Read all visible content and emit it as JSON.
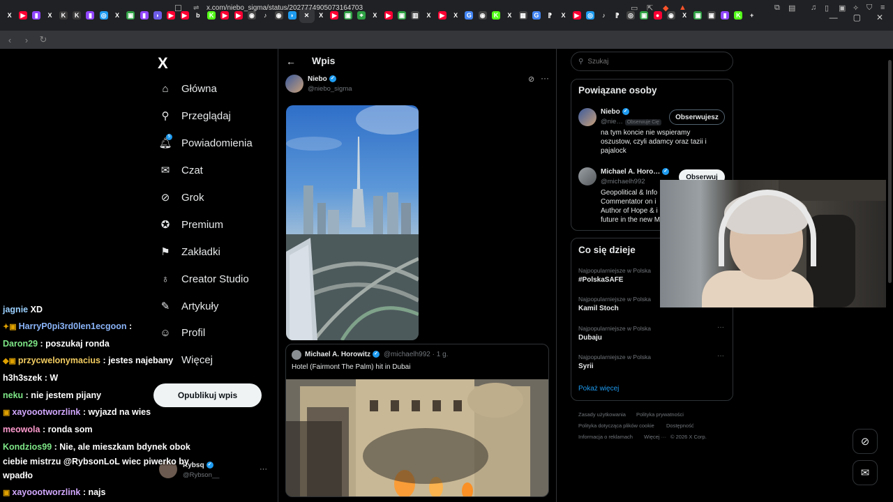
{
  "browser": {
    "tabs": [
      {
        "glyph": "X",
        "color": "#202124"
      },
      {
        "glyph": "▶",
        "color": "#ff0033"
      },
      {
        "glyph": "▮",
        "color": "#9146ff"
      },
      {
        "glyph": "X",
        "color": "#202124"
      },
      {
        "glyph": "K",
        "color": "#3a3a3a"
      },
      {
        "glyph": "K",
        "color": "#3a3a3a"
      },
      {
        "glyph": "▮",
        "color": "#9146ff"
      },
      {
        "glyph": "◎",
        "color": "#1d9bf0"
      },
      {
        "glyph": "X",
        "color": "#202124"
      },
      {
        "glyph": "▣",
        "color": "#2ea043"
      },
      {
        "glyph": "▮",
        "color": "#9146ff"
      },
      {
        "glyph": "◗",
        "color": "#6c5ce7"
      },
      {
        "glyph": "▶",
        "color": "#ff0033"
      },
      {
        "glyph": "▶",
        "color": "#ff0033"
      },
      {
        "glyph": "b",
        "color": "#202124"
      },
      {
        "glyph": "K",
        "color": "#53fc18"
      },
      {
        "glyph": "▶",
        "color": "#ff0033"
      },
      {
        "glyph": "▶",
        "color": "#ff0033"
      },
      {
        "glyph": "◉",
        "color": "#444"
      },
      {
        "glyph": "♪",
        "color": "#202124"
      },
      {
        "glyph": "◉",
        "color": "#444"
      },
      {
        "glyph": "◗",
        "color": "#1d9bf0"
      },
      {
        "glyph": "✕",
        "color": "#35363a"
      },
      {
        "glyph": "X",
        "color": "#202124"
      },
      {
        "glyph": "▶",
        "color": "#ff0033"
      },
      {
        "glyph": "▣",
        "color": "#2ea043"
      },
      {
        "glyph": "⌖",
        "color": "#2ea043"
      },
      {
        "glyph": "X",
        "color": "#202124"
      },
      {
        "glyph": "▶",
        "color": "#ff0033"
      },
      {
        "glyph": "▣",
        "color": "#2ea043"
      },
      {
        "glyph": "▥",
        "color": "#444"
      },
      {
        "glyph": "X",
        "color": "#202124"
      },
      {
        "glyph": "▶",
        "color": "#ff0033"
      },
      {
        "glyph": "X",
        "color": "#202124"
      },
      {
        "glyph": "G",
        "color": "#4285f4"
      },
      {
        "glyph": "◉",
        "color": "#444"
      },
      {
        "glyph": "K",
        "color": "#53fc18"
      },
      {
        "glyph": "X",
        "color": "#202124"
      },
      {
        "glyph": "▦",
        "color": "#444"
      },
      {
        "glyph": "G",
        "color": "#4285f4"
      },
      {
        "glyph": "⁋",
        "color": "#202124"
      },
      {
        "glyph": "X",
        "color": "#202124"
      },
      {
        "glyph": "▶",
        "color": "#ff0033"
      },
      {
        "glyph": "◎",
        "color": "#1d9bf0"
      },
      {
        "glyph": "♪",
        "color": "#202124"
      },
      {
        "glyph": "⁋",
        "color": "#202124"
      },
      {
        "glyph": "◎",
        "color": "#444"
      },
      {
        "glyph": "▣",
        "color": "#2ea043"
      },
      {
        "glyph": "●",
        "color": "#ff0033"
      },
      {
        "glyph": "◉",
        "color": "#444"
      },
      {
        "glyph": "X",
        "color": "#202124"
      },
      {
        "glyph": "▣",
        "color": "#2ea043"
      },
      {
        "glyph": "▣",
        "color": "#444"
      },
      {
        "glyph": "▮",
        "color": "#9146ff"
      },
      {
        "glyph": "K",
        "color": "#53fc18"
      },
      {
        "glyph": "+",
        "color": "#202124"
      }
    ],
    "url": "x.com/niebo_sigma/status/2027774905073164703"
  },
  "nav": {
    "logo": "X",
    "items": [
      {
        "label": "Główna",
        "icon": "home-icon",
        "glyph": "⌂"
      },
      {
        "label": "Przeglądaj",
        "icon": "search-icon",
        "glyph": "⚲"
      },
      {
        "label": "Powiadomienia",
        "icon": "bell-icon",
        "glyph": "🔔︎",
        "badge": "5"
      },
      {
        "label": "Czat",
        "icon": "mail-icon",
        "glyph": "✉"
      },
      {
        "label": "Grok",
        "icon": "grok-icon",
        "glyph": "⊘"
      },
      {
        "label": "Premium",
        "icon": "premium-icon",
        "glyph": "✪"
      },
      {
        "label": "Zakładki",
        "icon": "bookmark-icon",
        "glyph": "⚑"
      },
      {
        "label": "Creator Studio",
        "icon": "creator-icon",
        "glyph": "♁"
      },
      {
        "label": "Artykuły",
        "icon": "articles-icon",
        "glyph": "✎"
      },
      {
        "label": "Profil",
        "icon": "profile-icon",
        "glyph": "☺"
      },
      {
        "label": "Więcej",
        "icon": "more-icon",
        "glyph": "⋯"
      }
    ],
    "publish": "Opublikuj wpis",
    "account": {
      "name": "Rybsq",
      "handle": "@Rybson__"
    }
  },
  "post": {
    "header": "Wpis",
    "author": {
      "name": "Niebo",
      "handle": "@niebo_sigma"
    },
    "quote": {
      "name": "Michael A. Horowitz",
      "meta": "@michaelh992 · 1 g.",
      "text": "Hotel (Fairmont The Palm) hit in Dubai"
    }
  },
  "sidebar": {
    "search_placeholder": "Szukaj",
    "related_title": "Powiązane osoby",
    "related": [
      {
        "name": "Niebo",
        "handle": "@nie…",
        "follows_you": "Obserwuje Cię",
        "button": "Obserwujesz",
        "bio": [
          "na tym koncie nie wspieramy",
          "oszustow, czyli adamcy oraz tazii i",
          "pajalock"
        ]
      },
      {
        "name": "Michael A. Horo…",
        "handle": "@michaelh992",
        "button": "Obserwuj",
        "bio": [
          "Geopolitical & Info",
          "Commentator on i",
          "Author of Hope & i",
          "future in the new M"
        ]
      }
    ],
    "trends_title": "Co się dzieje",
    "trends": [
      {
        "context": "Najpopularniejsze w Polska",
        "name": "#PolskaSAFE"
      },
      {
        "context": "Najpopularniejsze w Polska",
        "name": "Kamil Stoch"
      },
      {
        "context": "Najpopularniejsze w Polska",
        "name": "Dubaju"
      },
      {
        "context": "Najpopularniejsze w Polska",
        "name": "Syrii"
      }
    ],
    "show_more": "Pokaż więcej",
    "footer": [
      "Zasady użytkowania",
      "Polityka prywatności",
      "Polityka dotycząca plików cookie",
      "Dostępność",
      "Informacja o reklamach",
      "Więcej ···",
      "© 2026 X Corp."
    ]
  },
  "chat": [
    {
      "user": "jagnie",
      "msg": "XD",
      "color": "#9ad0ff",
      "badges": ""
    },
    {
      "user": "HarryP0pi3rd0len1ecgoon",
      "msg": ":",
      "color": "#8ab4f8",
      "badges": "✦▣"
    },
    {
      "user": "Daron29",
      "msg": ": poszukaj ronda",
      "color": "#7ee787",
      "badges": ""
    },
    {
      "user": "przycwelonymacius",
      "msg": ": jestes najebany",
      "color": "#f2cc60",
      "badges": "◆▣"
    },
    {
      "user": "h3h3szek",
      "msg": ": W",
      "color": "#ffffff",
      "badges": ""
    },
    {
      "user": "neku",
      "msg": ": nie jestem pijany",
      "color": "#7ee787",
      "badges": ""
    },
    {
      "user": "xayoootworzlink",
      "msg": ": wyjazd na wies",
      "color": "#d2a8ff",
      "badges": "▣"
    },
    {
      "user": "meowola",
      "msg": ": ronda som",
      "color": "#ff9bce",
      "badges": ""
    },
    {
      "user": "Kondzios99",
      "msg": ": Nie, ale mieszkam bdynek obok",
      "color": "#7ee787",
      "badges": ""
    },
    {
      "user": "",
      "msg": "ciebie mistrzu @RybsonLoL wiec piwerko by",
      "color": "#ffffff",
      "badges": ""
    },
    {
      "user": "",
      "msg": "wpadło",
      "color": "#ffffff",
      "badges": ""
    },
    {
      "user": "xayoootworzlink",
      "msg": ": najs",
      "color": "#d2a8ff",
      "badges": "▣"
    }
  ]
}
